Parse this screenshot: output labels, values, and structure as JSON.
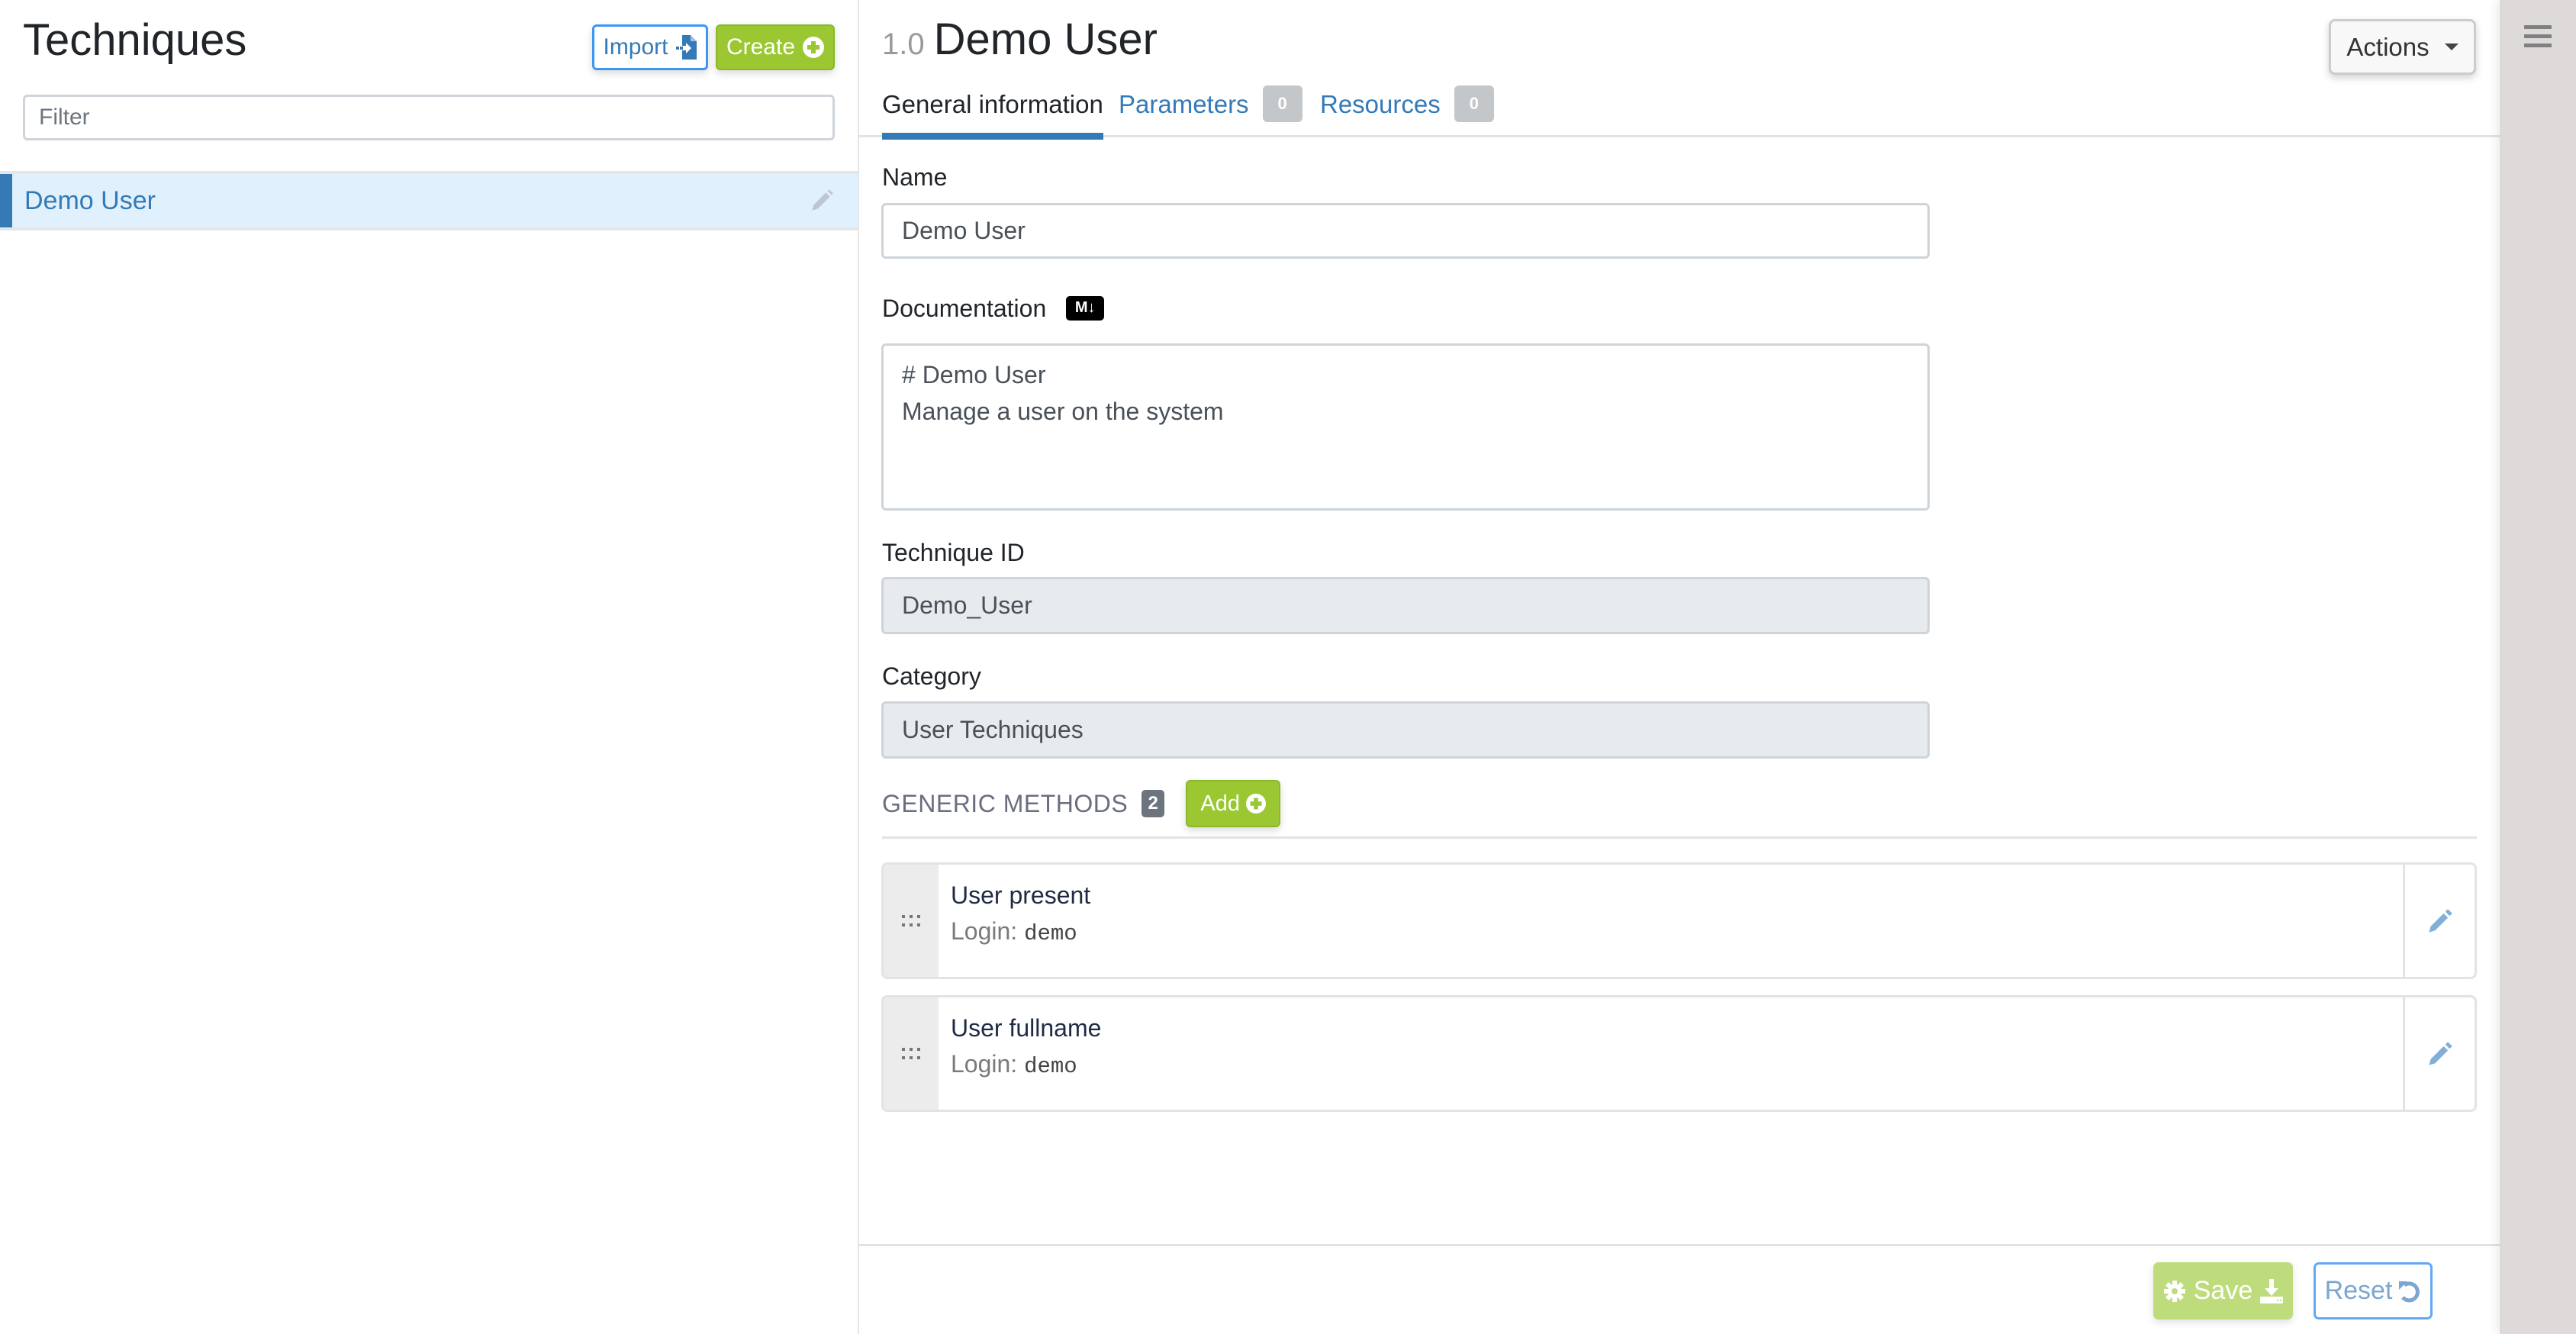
{
  "left_panel": {
    "title": "Techniques",
    "import_label": "Import",
    "create_label": "Create",
    "filter_placeholder": "Filter",
    "filter_value": "",
    "techniques": [
      {
        "name": "Demo User",
        "selected": true
      }
    ]
  },
  "header": {
    "version": "1.0",
    "title": "Demo User",
    "actions_label": "Actions"
  },
  "tabs": [
    {
      "label": "General information",
      "active": true
    },
    {
      "label": "Parameters",
      "count": "0"
    },
    {
      "label": "Resources",
      "count": "0"
    }
  ],
  "form": {
    "name_label": "Name",
    "name_value": "Demo User",
    "documentation_label": "Documentation",
    "markdown_badge": "M↓",
    "documentation_lines": [
      "# Demo User",
      "Manage a user on the system"
    ],
    "technique_id_label": "Technique ID",
    "technique_id_value": "Demo_User",
    "category_label": "Category",
    "category_value": "User Techniques"
  },
  "generic_methods": {
    "title": "GENERIC METHODS",
    "count": "2",
    "add_label": "Add",
    "items": [
      {
        "name": "User present",
        "param_label": "Login:",
        "param_value": "demo"
      },
      {
        "name": "User fullname",
        "param_label": "Login:",
        "param_value": "demo"
      }
    ]
  },
  "footer": {
    "save_label": "Save",
    "reset_label": "Reset"
  },
  "colors": {
    "primary": "#337ab7",
    "success": "#9bc832",
    "success_disabled": "#bfdc7c",
    "selected_row": "#e1f0fd"
  }
}
